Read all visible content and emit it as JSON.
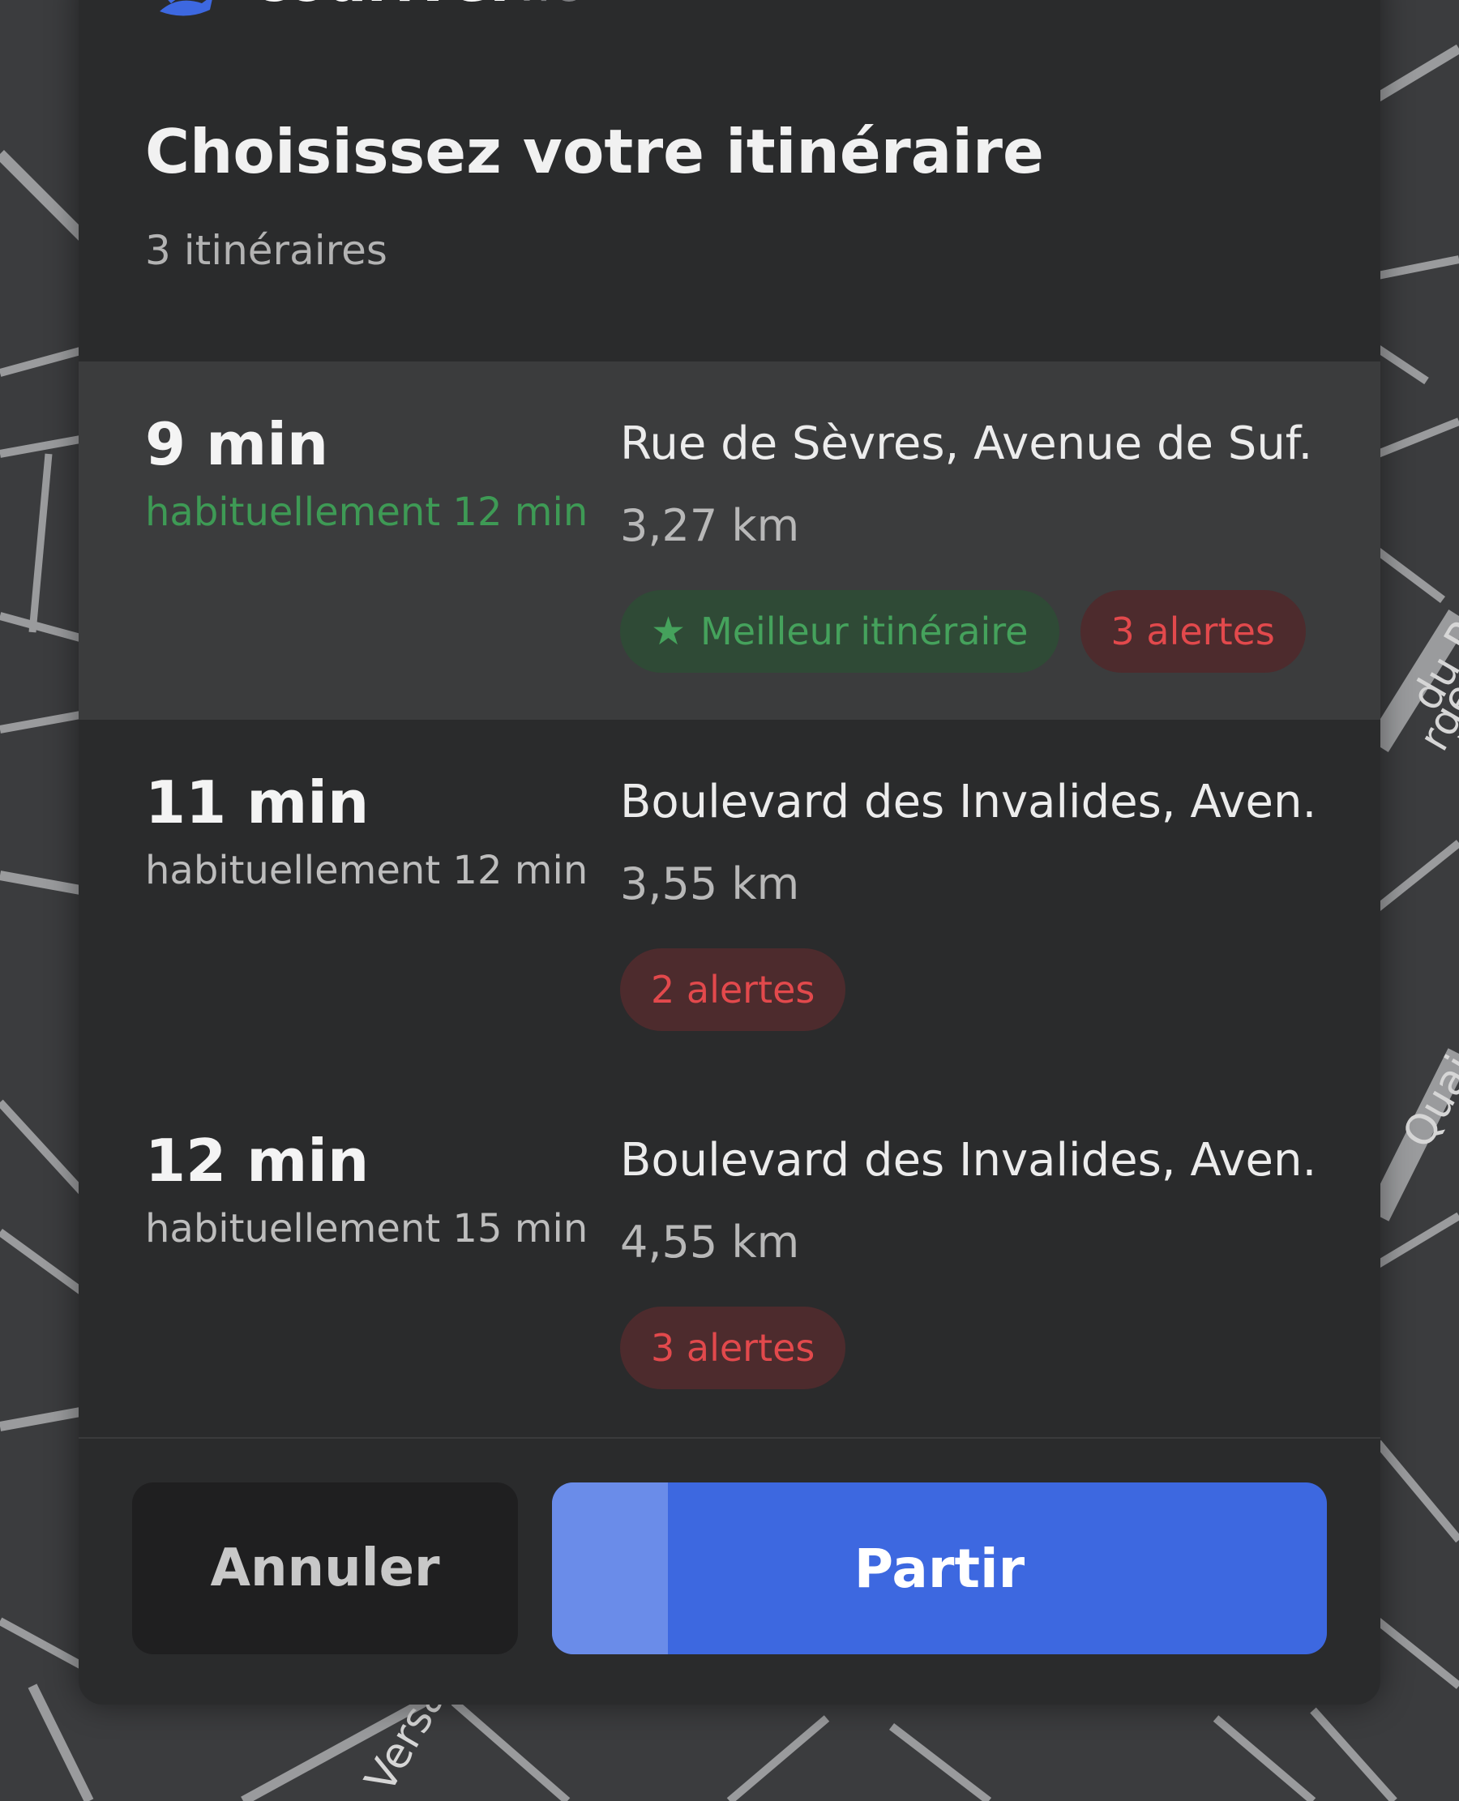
{
  "brand": {
    "name": "codriver",
    "tld": ".io",
    "accent": "#3d68e0"
  },
  "panel": {
    "title": "Choisissez votre itinéraire",
    "subtitle": "3 itinéraires"
  },
  "routes": [
    {
      "duration": "9 min",
      "usual": "habituellement 12 min",
      "street": "Rue de Sèvres, Avenue de Suf...",
      "distance": "3,27 km",
      "best_label": "Meilleur itinéraire",
      "alerts": "3 alertes",
      "selected": true
    },
    {
      "duration": "11 min",
      "usual": "habituellement 12 min",
      "street": "Boulevard des Invalides, Aven...",
      "distance": "3,55 km",
      "alerts": "2 alertes",
      "selected": false
    },
    {
      "duration": "12 min",
      "usual": "habituellement 15 min",
      "street": "Boulevard des Invalides, Aven...",
      "distance": "4,55 km",
      "alerts": "3 alertes",
      "selected": false
    }
  ],
  "footer": {
    "cancel_label": "Annuler",
    "go_label": "Partir",
    "go_countdown_progress": 0.15
  },
  "map": {
    "labels": [
      "Quai d",
      "Versa",
      "du Pré",
      "rges"
    ]
  },
  "colors": {
    "good": "#3e9a55",
    "alert": "#e2494c",
    "panel": "#2a2b2c"
  }
}
